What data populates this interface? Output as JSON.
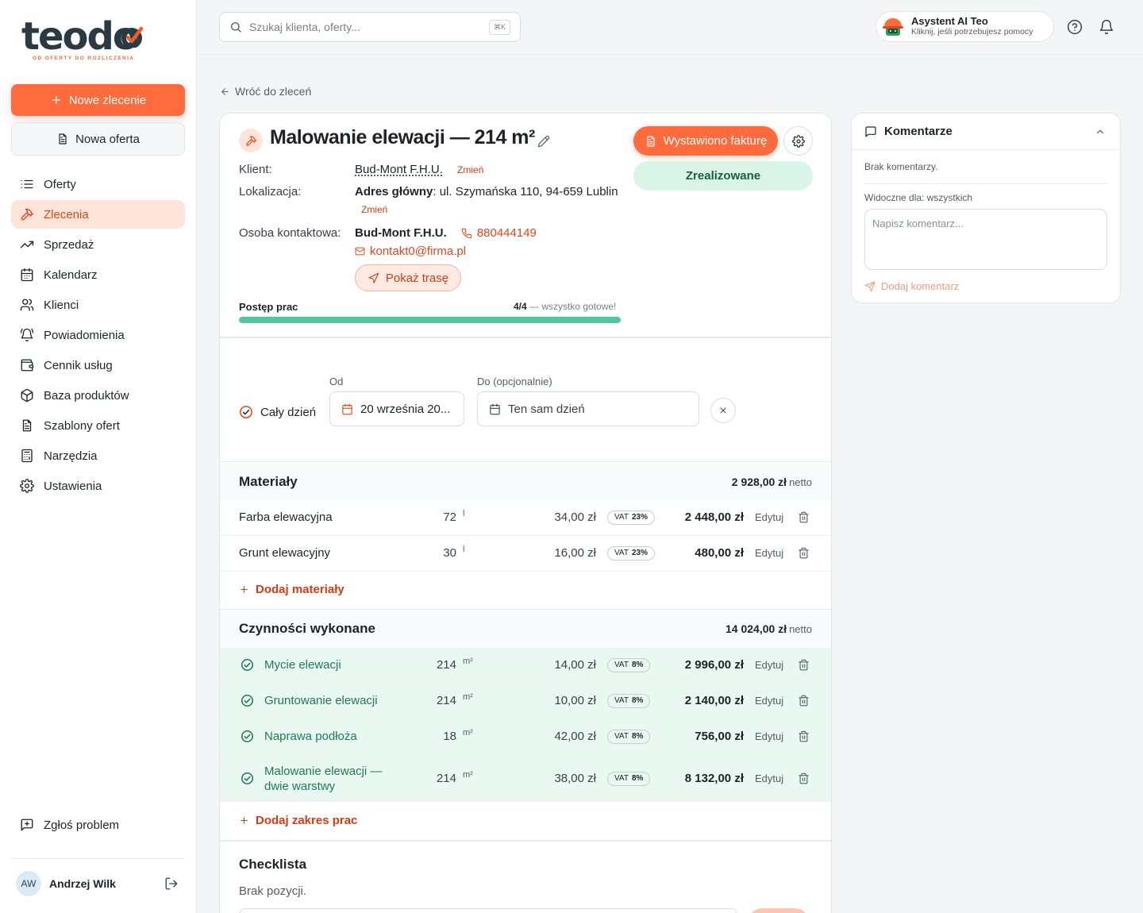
{
  "brand": {
    "logo_text": "teodo",
    "tagline": "OD OFERTY DO ROZLICZENIA",
    "accent": "#ff6b3d"
  },
  "sidebar": {
    "new_order_label": "Nowe zlecenie",
    "new_offer_label": "Nowa oferta",
    "items": [
      {
        "label": "Oferty",
        "icon": "list-icon",
        "active": false
      },
      {
        "label": "Zlecenia",
        "icon": "hammer-icon",
        "active": true
      },
      {
        "label": "Sprzedaż",
        "icon": "trending-up-icon",
        "active": false
      },
      {
        "label": "Kalendarz",
        "icon": "calendar-icon",
        "active": false
      },
      {
        "label": "Klienci",
        "icon": "users-icon",
        "active": false
      },
      {
        "label": "Powiadomienia",
        "icon": "bell-ring-icon",
        "active": false
      },
      {
        "label": "Cennik usług",
        "icon": "wallet-icon",
        "active": false
      },
      {
        "label": "Baza produktów",
        "icon": "box-icon",
        "active": false
      },
      {
        "label": "Szablony ofert",
        "icon": "file-icon",
        "active": false
      },
      {
        "label": "Narzędzia",
        "icon": "calculator-icon",
        "active": false
      },
      {
        "label": "Ustawienia",
        "icon": "gear-icon",
        "active": false
      }
    ],
    "report_label": "Zgłoś problem",
    "user": {
      "initials": "AW",
      "name": "Andrzej Wilk"
    }
  },
  "topbar": {
    "search_placeholder": "Szukaj klienta, oferty...",
    "search_shortcut": "⌘K",
    "assistant_title": "Asystent AI Teo",
    "assistant_sub": "Kliknij, jeśli potrzebujesz pomocy"
  },
  "back_label": "Wróć do zleceń",
  "order": {
    "title": "Malowanie elewacji — 214 m²",
    "invoice_label": "Wystawiono fakturę",
    "status": "Zrealizowane",
    "client_label": "Klient:",
    "client_value": "Bud-Mont F.H.U.",
    "change_label": "Zmień",
    "location_label": "Lokalizacja:",
    "location_main": "Adres główny",
    "location_value": ": ul. Szymańska 110, 94-659 Lublin",
    "contact_label": "Osoba kontaktowa:",
    "contact_name": "Bud-Mont F.H.U.",
    "contact_phone": "880444149",
    "contact_email": "kontakt0@firma.pl",
    "route_label": "Pokaż trasę",
    "progress_label": "Postęp prac",
    "progress_count": "4/4",
    "progress_note": " — wszystko gotowe!",
    "progress_fraction": 1.0
  },
  "dates": {
    "all_day_label": "Cały dzień",
    "from_label": "Od",
    "from_value": "20 września 20...",
    "to_label": "Do (opcjonalnie)",
    "to_placeholder": "Ten sam dzień"
  },
  "materials": {
    "title": "Materiały",
    "total": "2 928,00 zł",
    "net_label": "netto",
    "rows": [
      {
        "name": "Farba elewacyjna",
        "qty": "72",
        "unit": "l",
        "price": "34,00 zł",
        "vat_label": "VAT",
        "vat": "23%",
        "total": "2 448,00 zł",
        "edit": "Edytuj"
      },
      {
        "name": "Grunt elewacyjny",
        "qty": "30",
        "unit": "l",
        "price": "16,00 zł",
        "vat_label": "VAT",
        "vat": "23%",
        "total": "480,00 zł",
        "edit": "Edytuj"
      }
    ],
    "add_label": "Dodaj materiały"
  },
  "works": {
    "title": "Czynności wykonane",
    "total": "14 024,00 zł",
    "net_label": "netto",
    "rows": [
      {
        "name": "Mycie elewacji",
        "qty": "214",
        "unit": "m²",
        "price": "14,00 zł",
        "vat_label": "VAT",
        "vat": "8%",
        "total": "2 996,00 zł",
        "edit": "Edytuj"
      },
      {
        "name": "Gruntowanie elewacji",
        "qty": "214",
        "unit": "m²",
        "price": "10,00 zł",
        "vat_label": "VAT",
        "vat": "8%",
        "total": "2 140,00 zł",
        "edit": "Edytuj"
      },
      {
        "name": "Naprawa podłoża",
        "qty": "18",
        "unit": "m²",
        "price": "42,00 zł",
        "vat_label": "VAT",
        "vat": "8%",
        "total": "756,00 zł",
        "edit": "Edytuj"
      },
      {
        "name_line1": "Malowanie elewacji —",
        "name_line2": "dwie warstwy",
        "qty": "214",
        "unit": "m²",
        "price": "38,00 zł",
        "vat_label": "VAT",
        "vat": "8%",
        "total": "8 132,00 zł",
        "edit": "Edytuj"
      }
    ],
    "add_label": "Dodaj zakres prac"
  },
  "checklist": {
    "title": "Checklista",
    "empty": "Brak pozycji."
  },
  "comments": {
    "title": "Komentarze",
    "empty": "Brak komentarzy.",
    "visibility": "Widoczne dla: wszystkich",
    "placeholder": "Napisz komentarz...",
    "send_label": "Dodaj komentarz"
  }
}
